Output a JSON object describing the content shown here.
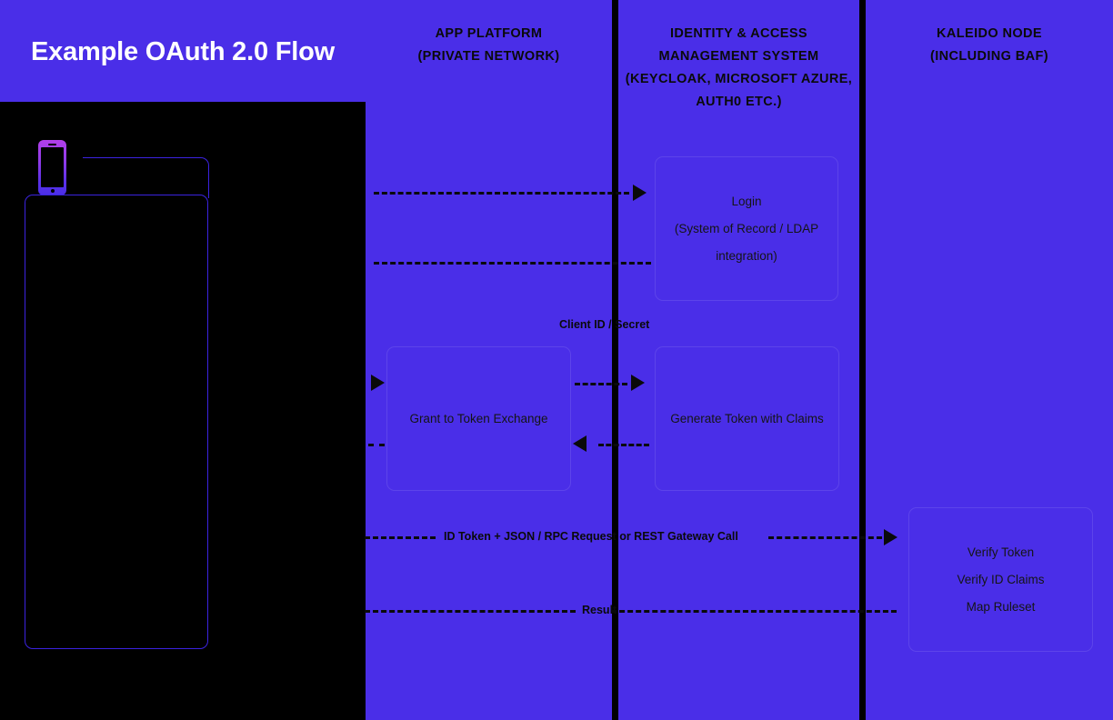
{
  "title": "Example OAuth 2.0 Flow",
  "columns": [
    {
      "id": "app-platform",
      "header": "APP PLATFORM\n(PRIVATE NETWORK)"
    },
    {
      "id": "iam-system",
      "header": "IDENTITY & ACCESS MANAGEMENT SYSTEM (KEYCLOAK, MICROSOFT AZURE, AUTH0 ETC.)"
    },
    {
      "id": "kaleido-node",
      "header": "KALEIDO NODE (INCLUDING BAF)"
    }
  ],
  "column_headers": {
    "app_platform": [
      "APP PLATFORM",
      "(PRIVATE NETWORK)"
    ],
    "iam_system": [
      "IDENTITY & ACCESS",
      "MANAGEMENT SYSTEM",
      "(KEYCLOAK, MICROSOFT AZURE,",
      "AUTH0 ETC.)"
    ],
    "kaleido_node": [
      "KALEIDO NODE",
      "(INCLUDING BAF)"
    ]
  },
  "boxes": {
    "login": [
      "Login",
      "(System of Record  / LDAP",
      "integration)"
    ],
    "grant": [
      "Grant to Token Exchange"
    ],
    "generate": [
      "Generate Token with Claims"
    ],
    "verify": [
      "Verify Token",
      "Verify ID Claims",
      "Map Ruleset"
    ]
  },
  "flow_labels": {
    "client_id_secret": "Client ID / Secret",
    "id_token_request": "ID Token + JSON / RPC Request or REST Gateway Call",
    "result": "Result"
  },
  "icons": {
    "device": "mobile-phone-icon",
    "arrows": "dashed-flow-arrow"
  },
  "colors": {
    "background_panel": "#000000",
    "lane": "#4A2EE8",
    "banner": "#4A2EE8",
    "divider": "#000000",
    "title_text": "#FFFFFF",
    "body_text": "#151515",
    "device_outline": "#3B23E0",
    "phone_gradient_start": "#B23FE9",
    "phone_gradient_end": "#4A2EE8"
  }
}
